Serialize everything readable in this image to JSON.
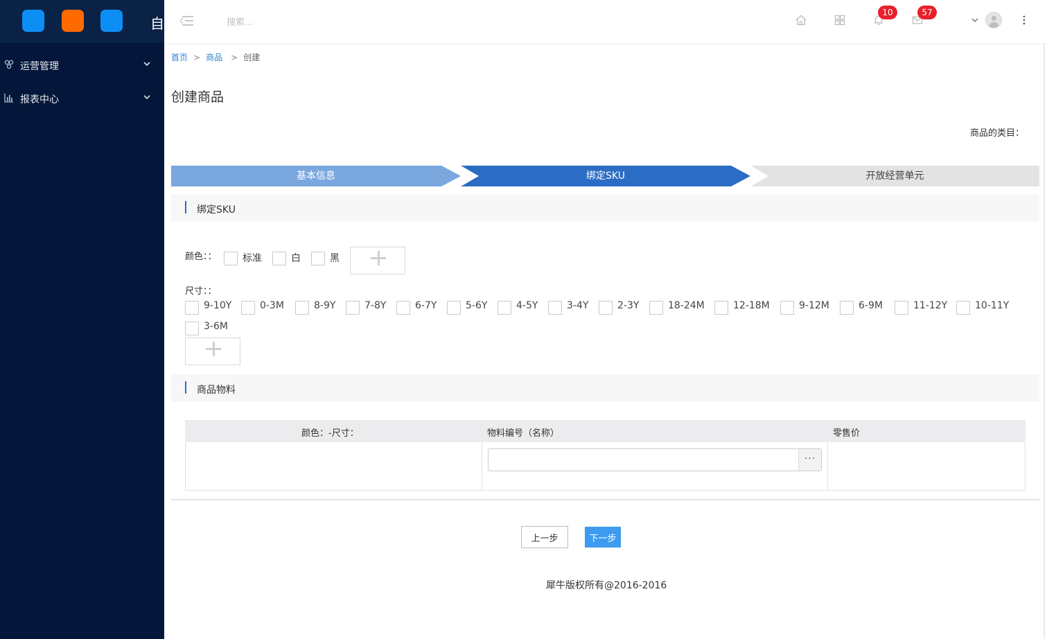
{
  "app": {
    "brand_char": "自",
    "icon_colors": [
      "#0d8ef5",
      "#ff6a00",
      "#0d8ef5"
    ]
  },
  "sidebar": {
    "items": [
      {
        "label": "运营管理",
        "icon": "cluster-icon"
      },
      {
        "label": "报表中心",
        "icon": "bar-chart-icon"
      }
    ]
  },
  "header": {
    "search_placeholder": "搜索...",
    "notifications_count": "10",
    "messages_count": "57"
  },
  "breadcrumb": {
    "home": "首页",
    "sep": ">",
    "product": "商品",
    "current": "创建"
  },
  "page": {
    "title": "创建商品",
    "category_label": "商品的类目："
  },
  "steps": [
    {
      "label": "基本信息",
      "state": "done"
    },
    {
      "label": "绑定SKU",
      "state": "active"
    },
    {
      "label": "开放经营单元",
      "state": "todo"
    }
  ],
  "sku_section": {
    "title": "绑定SKU",
    "color_label": "颜色：：",
    "color_options": [
      "标准",
      "白",
      "黑"
    ],
    "size_label": "尺寸：：",
    "size_options": [
      "9-10Y",
      "0-3M",
      "8-9Y",
      "7-8Y",
      "6-7Y",
      "5-6Y",
      "4-5Y",
      "3-4Y",
      "2-3Y",
      "18-24M",
      "12-18M",
      "9-12M",
      "6-9M",
      "11-12Y",
      "10-11Y",
      "3-6M"
    ]
  },
  "material_section": {
    "title": "商品物料",
    "columns": [
      "颜色：-尺寸：",
      "物料编号（名称）",
      "零售价"
    ],
    "more_button": "···"
  },
  "actions": {
    "prev": "上一步",
    "next": "下一步"
  },
  "footer": {
    "copyright": "犀牛版权所有@2016-2016"
  },
  "colors": {
    "sidebar_bg": "#04173a",
    "step_done": "#7aa7de",
    "step_active": "#2b6cc4",
    "step_todo": "#e3e3e3",
    "badge": "#e8202b",
    "primary_button": "#3d9bf0",
    "link": "#2f82d4"
  }
}
